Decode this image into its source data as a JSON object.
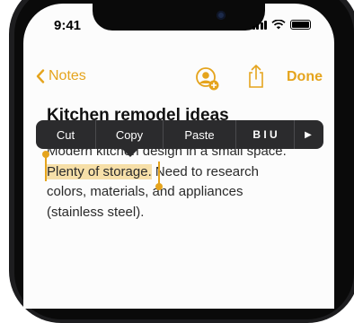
{
  "status_bar": {
    "time": "9:41"
  },
  "nav": {
    "back_label": "Notes",
    "done_label": "Done"
  },
  "note": {
    "title": "Kitchen remodel ideas",
    "lines": [
      "Modern kitchen design in a small space.",
      "Plenty of storage.",
      " Need to research",
      "colors, materials, and appliances",
      "(stainless steel)."
    ]
  },
  "edit_menu": {
    "cut": "Cut",
    "copy": "Copy",
    "paste": "Paste",
    "format": "B I U",
    "more": "▶"
  },
  "colors": {
    "accent": "#e5a41d",
    "selection": "#f6dfa8",
    "menu_bg": "#2b2b2d"
  },
  "icons": [
    "chevron-left-icon",
    "share-person-icon",
    "share-icon",
    "wifi-icon",
    "battery-icon",
    "signal-icon"
  ]
}
